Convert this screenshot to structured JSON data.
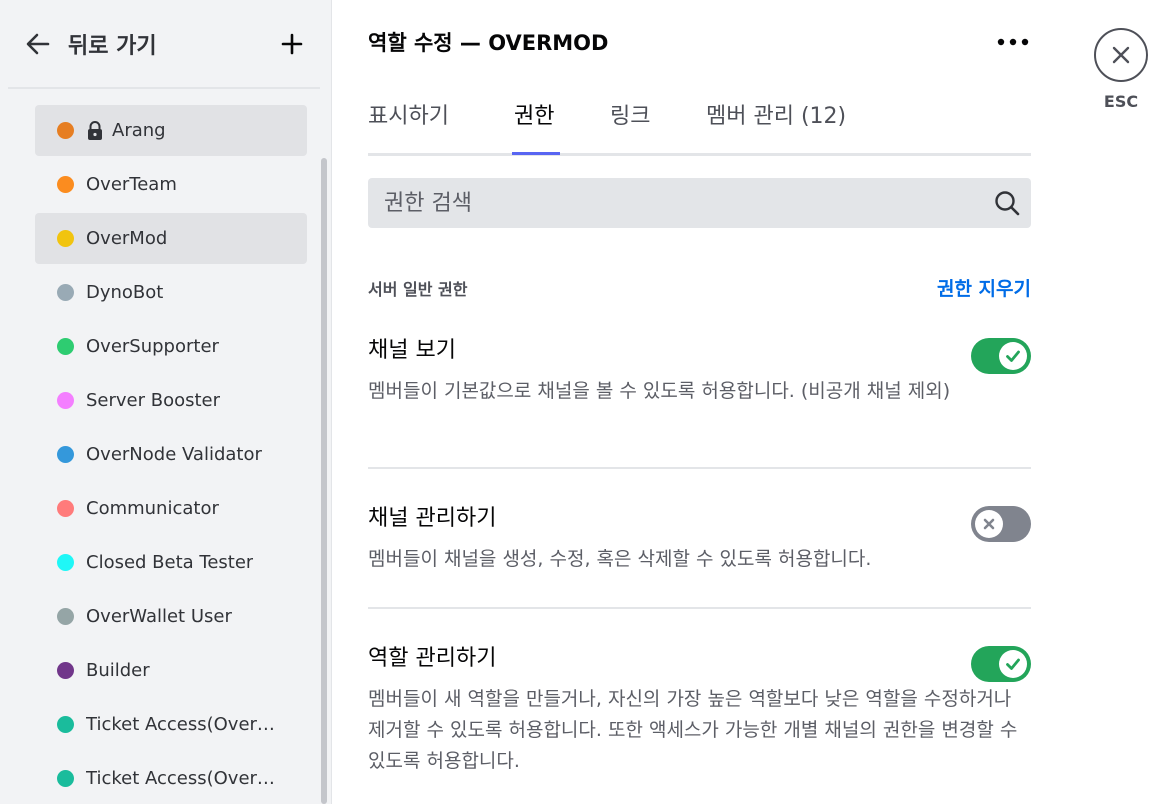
{
  "sidebar": {
    "back_label": "뒤로 가기",
    "roles": [
      {
        "name": "Arang",
        "color": "#e67e22",
        "locked": true
      },
      {
        "name": "OverTeam",
        "color": "#fb8c1f",
        "locked": false
      },
      {
        "name": "OverMod",
        "color": "#f1c40f",
        "locked": false,
        "selected": true
      },
      {
        "name": "DynoBot",
        "color": "#99aab5",
        "locked": false
      },
      {
        "name": "OverSupporter",
        "color": "#2ecc71",
        "locked": false
      },
      {
        "name": "Server Booster",
        "color": "#f47fff",
        "locked": false
      },
      {
        "name": "OverNode Validator",
        "color": "#3498db",
        "locked": false
      },
      {
        "name": "Communicator",
        "color": "#ff7b7b",
        "locked": false
      },
      {
        "name": "Closed Beta Tester",
        "color": "#1ff7f7",
        "locked": false
      },
      {
        "name": "OverWallet User",
        "color": "#95a5a6",
        "locked": false
      },
      {
        "name": "Builder",
        "color": "#71368a",
        "locked": false
      },
      {
        "name": "Ticket Access(Over…",
        "color": "#1abc9c",
        "locked": false
      },
      {
        "name": "Ticket Access(OverN…",
        "color": "#1abc9c",
        "locked": false
      }
    ]
  },
  "header": {
    "title": "역할 수정 — OVERMOD"
  },
  "tabs": [
    {
      "label": "표시하기",
      "active": false
    },
    {
      "label": "권한",
      "active": true
    },
    {
      "label": "링크",
      "active": false
    },
    {
      "label": "멤버 관리 (12)",
      "active": false
    }
  ],
  "search": {
    "placeholder": "권한 검색"
  },
  "section": {
    "title": "서버 일반 권한",
    "clear_label": "권한 지우기"
  },
  "permissions": [
    {
      "title": "채널 보기",
      "description": "멤버들이 기본값으로 채널을 볼 수 있도록 허용합니다. (비공개 채널 제외)",
      "enabled": true
    },
    {
      "title": "채널 관리하기",
      "description": "멤버들이 채널을 생성, 수정, 혹은 삭제할 수 있도록 허용합니다.",
      "enabled": false
    },
    {
      "title": "역할 관리하기",
      "description": "멤버들이 새 역할을 만들거나, 자신의 가장 높은 역할보다 낮은 역할을 수정하거나 제거할 수 있도록 허용합니다. 또한 액세스가 가능한 개별 채널의 권한을 변경할 수 있도록 허용합니다.",
      "enabled": true
    }
  ],
  "close": {
    "label": "ESC"
  },
  "colors": {
    "accent": "#5865f2",
    "link": "#006ce7",
    "toggle_on": "#23a55a",
    "toggle_off": "#80848e"
  }
}
